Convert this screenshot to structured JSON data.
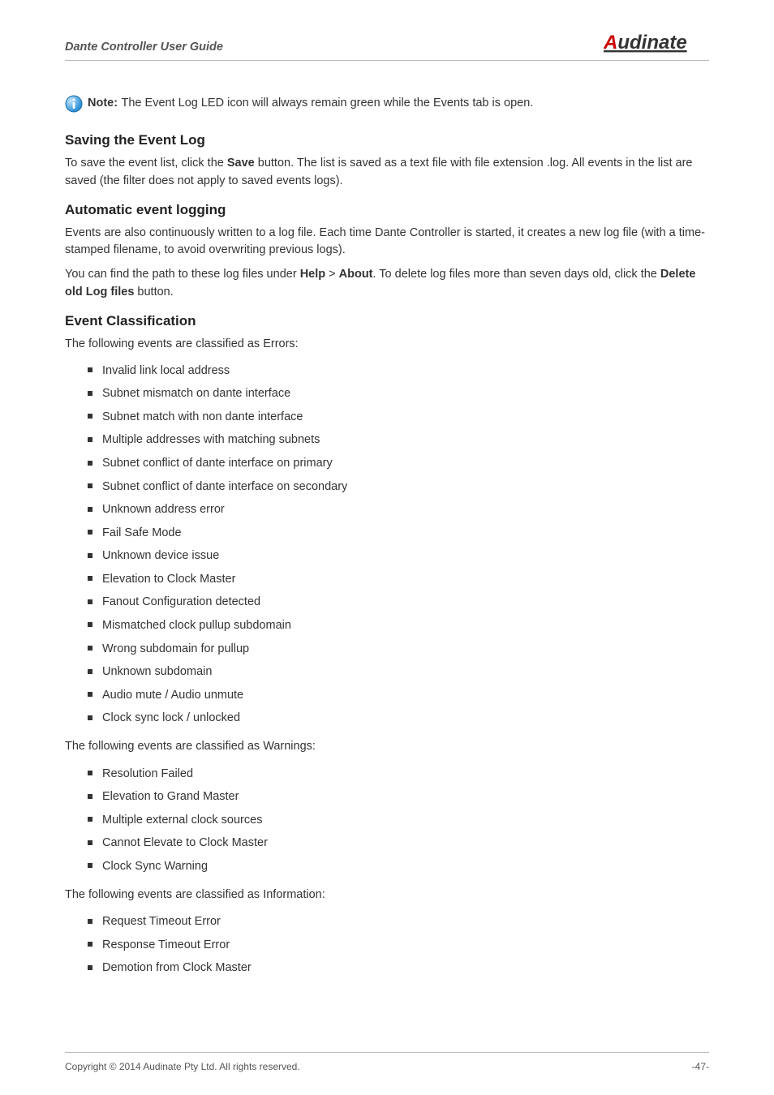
{
  "header": {
    "guide_title": "Dante Controller User Guide",
    "logo_text_first_char": "A",
    "logo_text_rest": "udinate"
  },
  "note": {
    "label": "Note:",
    "text": "The Event Log LED icon will always remain green while the Events tab is open."
  },
  "sections": {
    "saving": {
      "heading": "Saving the Event Log",
      "p1_a": "To save the event list, click the ",
      "p1_bold": "Save",
      "p1_b": " button. The list is saved as a text file with file extension .log. All events in the list are saved (the filter does not apply to saved events logs)."
    },
    "automatic": {
      "heading": "Automatic event logging",
      "p1": "Events are also continuously written to a log file. Each time Dante Controller is started, it creates a new log file (with a time-stamped filename, to avoid overwriting previous logs).",
      "p2_a": "You can find the path to these log files under ",
      "p2_help": "Help",
      "p2_sep": " > ",
      "p2_about": "About",
      "p2_b": ". To delete log files more than seven days old, click the ",
      "p2_delete": "Delete old Log files",
      "p2_c": " button."
    },
    "classification": {
      "heading": "Event Classification",
      "errors_intro": "The following events are classified as Errors:",
      "errors": [
        "Invalid link local address",
        "Subnet mismatch on dante interface",
        "Subnet match with non dante interface",
        "Multiple addresses with matching subnets",
        "Subnet conflict of dante interface on primary",
        "Subnet conflict of dante interface on secondary",
        "Unknown address error",
        "Fail Safe Mode",
        "Unknown device issue",
        "Elevation to Clock Master",
        "Fanout Configuration detected",
        "Mismatched clock pullup subdomain",
        "Wrong subdomain for pullup",
        "Unknown subdomain",
        "Audio mute / Audio unmute",
        "Clock sync lock / unlocked"
      ],
      "warnings_intro": "The following events are classified as Warnings:",
      "warnings": [
        "Resolution Failed",
        "Elevation to Grand Master",
        "Multiple external clock sources",
        "Cannot Elevate to Clock Master",
        "Clock Sync Warning"
      ],
      "info_intro": "The following events are classified as Information:",
      "information": [
        "Request Timeout Error",
        "Response Timeout Error",
        "Demotion from Clock Master"
      ]
    }
  },
  "footer": {
    "copyright": "Copyright © 2014 Audinate Pty Ltd. All rights reserved.",
    "page_number": "-47-"
  }
}
